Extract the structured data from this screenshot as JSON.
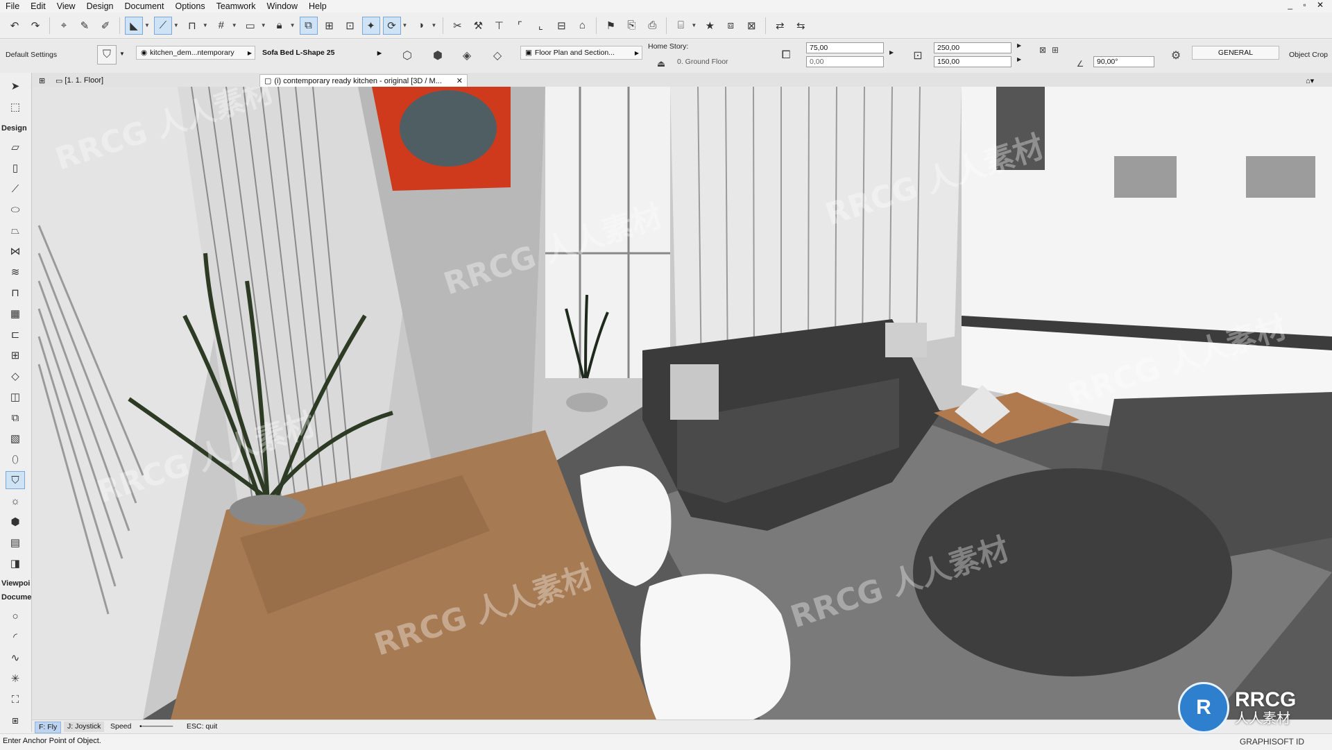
{
  "menu": [
    "File",
    "Edit",
    "View",
    "Design",
    "Document",
    "Options",
    "Teamwork",
    "Window",
    "Help"
  ],
  "window_controls": "_ ▫ ✕",
  "infobox": {
    "settings_label": "Default Settings",
    "layer_value": "kitchen_dem...ntemporary",
    "object_name": "Sofa Bed L-Shape 25",
    "floorplan_label": "Floor Plan and Section...",
    "home_story_label": "Home Story:",
    "home_story_value": "0. Ground Floor",
    "height_value": "75,00",
    "offset_value": "0,00",
    "width_value": "250,00",
    "depth_value": "150,00",
    "angle_value": "90,00°",
    "general_label": "GENERAL",
    "object_crop_label": "Object Crop"
  },
  "toolbox": {
    "design_label": "Design",
    "viewpoint_label": "Viewpoi",
    "document_label": "Docume"
  },
  "tabs": {
    "floor_tab": "[1. 1. Floor]",
    "view_tab": "(i) contemporary ready kitchen - original [3D / M..."
  },
  "status": {
    "fly": "F: Fly",
    "joystick": "J: Joystick",
    "speed": "Speed",
    "quit": "ESC: quit"
  },
  "prompt": "Enter Anchor Point of Object.",
  "brand": "GRAPHISOFT ID",
  "watermark": {
    "logo_letters": "R",
    "title": "RRCG",
    "subtitle": "人人素材",
    "repeat": "RRCG 人人素材"
  },
  "colors": {
    "accent": "#cfe3f7",
    "painting_frame": "#d03a1c"
  }
}
